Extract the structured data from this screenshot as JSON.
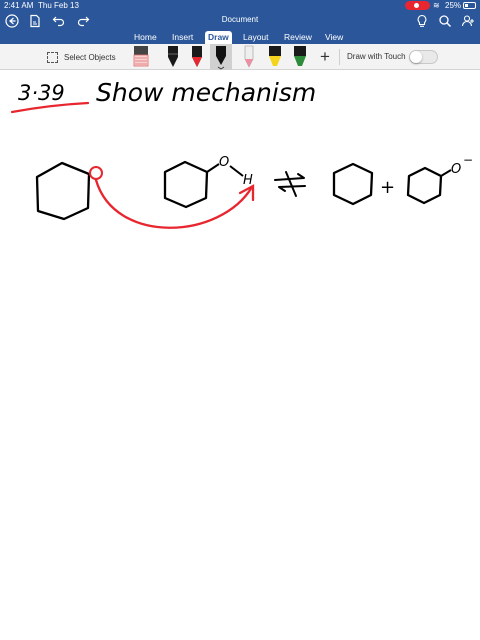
{
  "status_bar": {
    "time": "2:41 AM",
    "date": "Thu Feb 13",
    "battery": "25%"
  },
  "document": {
    "title": "Document"
  },
  "ribbon": {
    "tabs": [
      {
        "label": "Home"
      },
      {
        "label": "Insert"
      },
      {
        "label": "Draw",
        "active": true
      },
      {
        "label": "Layout"
      },
      {
        "label": "Review"
      },
      {
        "label": "View"
      }
    ]
  },
  "toolbar": {
    "select_objects_label": "Select Objects",
    "tools": [
      {
        "name": "eraser-tool-icon",
        "color": "#e06b6b"
      },
      {
        "name": "black-pen-icon",
        "color": "#1a1a1a"
      },
      {
        "name": "red-pen-icon",
        "color": "#e8262f"
      },
      {
        "name": "black-pen-selected-icon",
        "color": "#111111"
      },
      {
        "name": "pink-pencil-icon",
        "color": "#f08fa3"
      },
      {
        "name": "yellow-highlighter-icon",
        "color": "#f4d41c"
      },
      {
        "name": "green-highlighter-icon",
        "color": "#2e8b3a"
      }
    ],
    "draw_with_touch_label": "Draw with Touch",
    "draw_with_touch_on": false
  },
  "canvas": {
    "problem_number": "3·39",
    "heading": "Show mechanism",
    "atom_labels": {
      "oxygen": "O",
      "hydrogen": "H",
      "oxide": "O",
      "charge": "−"
    },
    "reaction_sign": "+",
    "ink_colors": {
      "black": "#000000",
      "red": "#e8262f"
    }
  }
}
